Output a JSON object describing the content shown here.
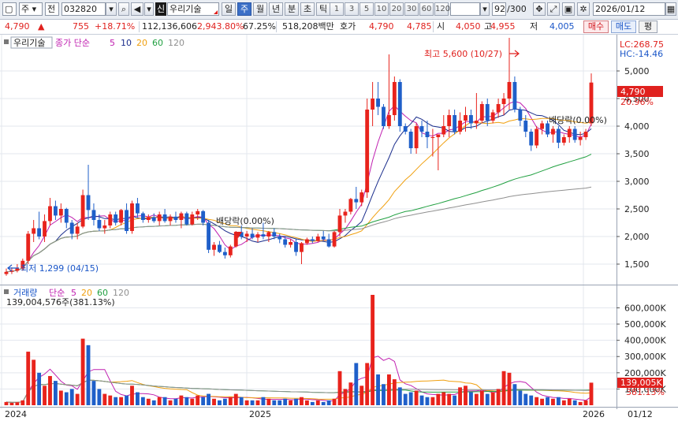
{
  "toolbar": {
    "type_label": "주",
    "market_label": "전",
    "code_value": "032820",
    "shin_badge": "신",
    "stock_name": "우리기술",
    "periods": [
      "일",
      "주",
      "월",
      "년",
      "분",
      "초",
      "틱"
    ],
    "selected_period": "주",
    "intervals": [
      "1",
      "3",
      "5",
      "10",
      "20",
      "30",
      "60",
      "120"
    ],
    "count_value": "92",
    "count_total": "/300",
    "date_value": "2026/01/12"
  },
  "info": {
    "price": "4,790",
    "change": "755",
    "change_rate": "+18.71%",
    "volume": "112,136,606",
    "volume_rate": "2,943.80%",
    "turnover": "67.25%",
    "amount": "518,208백만",
    "quote_label": "호가",
    "ask": "4,790",
    "bid": "4,785",
    "open_label": "시",
    "open": "4,050",
    "high_label": "고",
    "high": "4,955",
    "low_label": "저",
    "low": "4,005",
    "buy_label": "매수",
    "sell_label": "매도",
    "eval_label": "평"
  },
  "price_panel": {
    "name_tag": "우리기술",
    "legend_prefix": "종가 단순",
    "ma_periods": [
      "5",
      "10",
      "20",
      "60",
      "120"
    ],
    "lc_label": "LC:268.75",
    "hc_label": "HC:-14.46",
    "high_annotation": "최고 5,600 (10/27)",
    "low_annotation": "최저 1,299 (04/15)",
    "dividend_annotation_1": "배당락(0.00%)",
    "dividend_annotation_2": "배당락(0.00%)",
    "y_ticks": [
      "5,000",
      "4,500",
      "4,000",
      "3,500",
      "3,000",
      "2,500",
      "2,000",
      "1,500"
    ],
    "current_price_tag": "4,790",
    "current_rate_tag": "20.96%"
  },
  "volume_panel": {
    "name_tag": "거래량",
    "legend_prefix": "단순",
    "ma_periods": [
      "5",
      "20",
      "60",
      "120"
    ],
    "info_line": "139,004,576주(381.13%)",
    "y_ticks": [
      "600,000K",
      "500,000K",
      "400,000K",
      "300,000K",
      "200,000K",
      "100,000K"
    ],
    "current_volume_tag": "139,005K",
    "current_rate_tag": "381.13%"
  },
  "x_axis": {
    "labels": [
      "2024",
      "2025",
      "2026"
    ],
    "right_date": "01/12"
  },
  "colors": {
    "up": "#e8231c",
    "down": "#1f5fc9",
    "ma5": "#c020b0",
    "ma10": "#1a2d8c",
    "ma20": "#f0a010",
    "ma60": "#20a040",
    "ma120": "#909090"
  },
  "chart_data": {
    "type": "candlestick",
    "price_range": [
      1200,
      5400
    ],
    "volume_max_k": 680000,
    "candles": [
      [
        1320,
        1420,
        1290,
        1360,
        20000.0
      ],
      [
        1360,
        1440,
        1320,
        1380,
        15000.0
      ],
      [
        1380,
        1500,
        1350,
        1420,
        18000.0
      ],
      [
        1420,
        1600,
        1380,
        1560,
        30000.0
      ],
      [
        1560,
        2100,
        1500,
        2050,
        330000.0
      ],
      [
        2050,
        2300,
        1900,
        2150,
        280000.0
      ],
      [
        2150,
        2450,
        1950,
        2000,
        200000.0
      ],
      [
        2000,
        2400,
        1900,
        2280,
        120000.0
      ],
      [
        2280,
        2700,
        2200,
        2550,
        180000.0
      ],
      [
        2550,
        2650,
        2300,
        2380,
        150000.0
      ],
      [
        2380,
        2600,
        2250,
        2500,
        90000.0
      ],
      [
        2500,
        2520,
        2150,
        2250,
        80000.0
      ],
      [
        2250,
        2300,
        1950,
        2050,
        100000.0
      ],
      [
        2050,
        2250,
        1950,
        2180,
        70000.0
      ],
      [
        2180,
        2850,
        2150,
        2750,
        410000.0
      ],
      [
        2750,
        3300,
        2300,
        2480,
        370000.0
      ],
      [
        2480,
        2600,
        2200,
        2300,
        150000.0
      ],
      [
        2300,
        2400,
        2100,
        2150,
        100000.0
      ],
      [
        2150,
        2300,
        2050,
        2200,
        70000.0
      ],
      [
        2200,
        2450,
        2150,
        2400,
        60000.0
      ],
      [
        2400,
        2450,
        2200,
        2250,
        50000.0
      ],
      [
        2250,
        2500,
        2200,
        2480,
        50000.0
      ],
      [
        2480,
        2600,
        2050,
        2100,
        60000.0
      ],
      [
        2100,
        2650,
        2050,
        2600,
        120000.0
      ],
      [
        2600,
        2700,
        2350,
        2420,
        80000.0
      ],
      [
        2420,
        2450,
        2250,
        2300,
        50000.0
      ],
      [
        2300,
        2400,
        2250,
        2350,
        40000.0
      ],
      [
        2350,
        2420,
        2250,
        2280,
        30000.0
      ],
      [
        2280,
        2450,
        2200,
        2400,
        50000.0
      ],
      [
        2400,
        2500,
        2250,
        2280,
        50000.0
      ],
      [
        2280,
        2400,
        2200,
        2360,
        30000.0
      ],
      [
        2360,
        2450,
        2250,
        2300,
        40000.0
      ],
      [
        2300,
        2450,
        2150,
        2420,
        60000.0
      ],
      [
        2420,
        2450,
        2200,
        2220,
        50000.0
      ],
      [
        2220,
        2450,
        2200,
        2400,
        40000.0
      ],
      [
        2400,
        2500,
        2300,
        2460,
        60000.0
      ],
      [
        2460,
        2480,
        2200,
        2250,
        50000.0
      ],
      [
        2250,
        2300,
        1700,
        1760,
        70000.0
      ],
      [
        1760,
        1900,
        1650,
        1850,
        40000.0
      ],
      [
        1850,
        1920,
        1700,
        1720,
        30000.0
      ],
      [
        1720,
        1800,
        1600,
        1660,
        40000.0
      ],
      [
        1660,
        1850,
        1620,
        1820,
        50000.0
      ],
      [
        1820,
        2100,
        1800,
        2080,
        70000.0
      ],
      [
        2080,
        2200,
        1950,
        2000,
        50000.0
      ],
      [
        2000,
        2100,
        1900,
        2050,
        30000.0
      ],
      [
        2050,
        2150,
        1950,
        1980,
        30000.0
      ],
      [
        1980,
        2080,
        1900,
        2040,
        30000.0
      ],
      [
        2040,
        2250,
        1950,
        2000,
        50000.0
      ],
      [
        2000,
        2100,
        1900,
        2080,
        40000.0
      ],
      [
        2080,
        2150,
        1950,
        2000,
        30000.0
      ],
      [
        2000,
        2050,
        1880,
        1950,
        30000.0
      ],
      [
        1950,
        2000,
        1800,
        1850,
        40000.0
      ],
      [
        1850,
        1950,
        1800,
        1900,
        30000.0
      ],
      [
        1900,
        1950,
        1650,
        1720,
        40000.0
      ],
      [
        1720,
        1900,
        1500,
        1880,
        50000.0
      ],
      [
        1880,
        1980,
        1850,
        1950,
        30000.0
      ],
      [
        1950,
        2000,
        1880,
        1920,
        20000.0
      ],
      [
        1920,
        2050,
        1900,
        2000,
        30000.0
      ],
      [
        2000,
        2100,
        1920,
        1950,
        20000.0
      ],
      [
        1950,
        2050,
        1800,
        1820,
        30000.0
      ],
      [
        1820,
        2100,
        1800,
        2080,
        40000.0
      ],
      [
        2080,
        2500,
        2000,
        2380,
        210000.0
      ],
      [
        2380,
        2500,
        2250,
        2450,
        100000.0
      ],
      [
        2450,
        2700,
        2400,
        2680,
        140000.0
      ],
      [
        2680,
        2900,
        2500,
        2620,
        260000.0
      ],
      [
        2620,
        2850,
        2550,
        2800,
        120000.0
      ],
      [
        2800,
        4500,
        2700,
        4300,
        260000.0
      ],
      [
        4300,
        4800,
        4000,
        4500,
        680000.0
      ],
      [
        4500,
        4800,
        4200,
        4350,
        190000.0
      ],
      [
        4350,
        4400,
        3950,
        4000,
        130000.0
      ],
      [
        4000,
        5300,
        3950,
        4200,
        190000.0
      ],
      [
        4200,
        4900,
        4100,
        4800,
        160000.0
      ],
      [
        4800,
        4850,
        3900,
        4000,
        110000.0
      ],
      [
        4000,
        4050,
        3850,
        3900,
        70000.0
      ],
      [
        3900,
        3950,
        3500,
        3600,
        80000.0
      ],
      [
        3600,
        4050,
        3500,
        4000,
        90000.0
      ],
      [
        4000,
        4100,
        3800,
        3900,
        60000.0
      ],
      [
        3900,
        4100,
        3600,
        3800,
        50000.0
      ],
      [
        3800,
        3950,
        3450,
        3800,
        50000.0
      ],
      [
        3800,
        3850,
        3200,
        3850,
        70000.0
      ],
      [
        3850,
        4200,
        3800,
        4000,
        80000.0
      ],
      [
        4000,
        4300,
        3800,
        4200,
        70000.0
      ],
      [
        4200,
        4300,
        3850,
        3900,
        60000.0
      ],
      [
        3900,
        4250,
        3850,
        4100,
        110000.0
      ],
      [
        4100,
        4350,
        3900,
        4200,
        120000.0
      ],
      [
        4200,
        4300,
        3950,
        4050,
        80000.0
      ],
      [
        4050,
        4600,
        3950,
        4100,
        70000.0
      ],
      [
        4100,
        4450,
        4050,
        4400,
        90000.0
      ],
      [
        4400,
        4500,
        4000,
        4100,
        70000.0
      ],
      [
        4100,
        4300,
        4050,
        4250,
        80000.0
      ],
      [
        4250,
        4500,
        4150,
        4400,
        100000.0
      ],
      [
        4400,
        4600,
        4200,
        4500,
        210000.0
      ],
      [
        4500,
        5600,
        4300,
        4800,
        200000.0
      ],
      [
        4800,
        4900,
        4250,
        4300,
        130000.0
      ],
      [
        4300,
        4350,
        4000,
        4100,
        90000.0
      ],
      [
        4100,
        4200,
        3800,
        3900,
        70000.0
      ],
      [
        3900,
        3950,
        3550,
        3650,
        60000.0
      ],
      [
        3650,
        4000,
        3600,
        3950,
        50000.0
      ],
      [
        3950,
        4100,
        3850,
        4050,
        40000.0
      ],
      [
        4050,
        4100,
        3800,
        3850,
        50000.0
      ],
      [
        3850,
        4000,
        3700,
        3950,
        40000.0
      ],
      [
        3950,
        4000,
        3600,
        3700,
        50000.0
      ],
      [
        3700,
        3850,
        3650,
        3800,
        30000.0
      ],
      [
        3800,
        4000,
        3700,
        3950,
        40000.0
      ],
      [
        3950,
        4000,
        3700,
        3750,
        30000.0
      ],
      [
        3750,
        3900,
        3650,
        3800,
        20000.0
      ],
      [
        3800,
        3950,
        3750,
        3900,
        30000.0
      ],
      [
        4050,
        4955,
        4005,
        4790,
        139005
      ]
    ]
  }
}
